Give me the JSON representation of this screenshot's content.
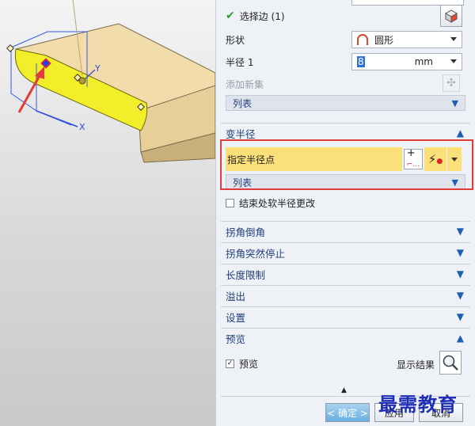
{
  "panel": {
    "select_edge": "选择边 (1)",
    "shape_label": "形状",
    "shape_value": "圆形",
    "radius_label": "半径 1",
    "radius_value": "8",
    "radius_unit": "mm",
    "add_new_set": "添加新集",
    "list_label": "列表",
    "variable_radius": {
      "title": "变半径",
      "specify_point": "指定半径点",
      "list_label": "列表"
    },
    "soft_radius_end": "结束处软半径更改",
    "sections": [
      "拐角倒角",
      "拐角突然停止",
      "长度限制",
      "溢出",
      "设置"
    ],
    "preview": {
      "title": "预览",
      "checkbox_label": "预览",
      "show_result": "显示结果"
    },
    "footer": {
      "ok": "< 确定 >",
      "apply": "应用",
      "cancel": "取消"
    }
  },
  "viewport": {
    "axis_x": "X",
    "axis_y": "Y"
  },
  "watermark": "最需教育",
  "colors": {
    "highlight": "#fbe079",
    "accent": "#1d5fb0",
    "red_box": "#e23b3b",
    "edge_yellow": "#f3ee2a",
    "block": "#f2dcac"
  }
}
